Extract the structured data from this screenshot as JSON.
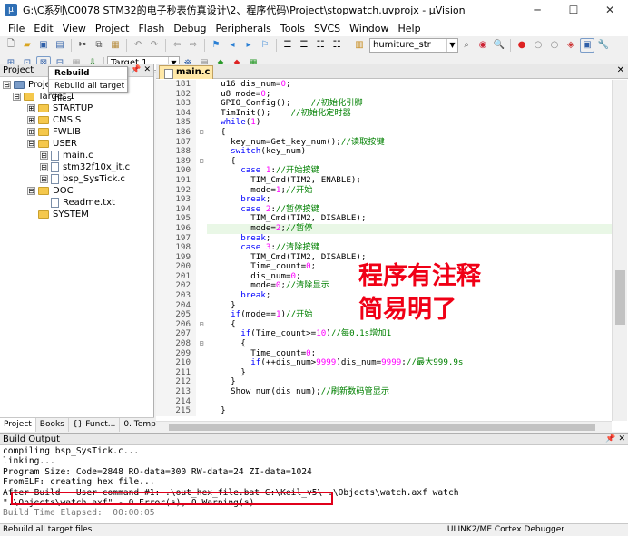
{
  "window": {
    "title": "G:\\C系列\\C0078 STM32的电子秒表仿真设计\\2、程序代码\\Project\\stopwatch.uvprojx - µVision",
    "minimize": "─",
    "maximize": "☐",
    "close": "✕"
  },
  "menu": [
    "File",
    "Edit",
    "View",
    "Project",
    "Flash",
    "Debug",
    "Peripherals",
    "Tools",
    "SVCS",
    "Window",
    "Help"
  ],
  "toolbar": {
    "find_combo": "humiture_str",
    "target_combo": "Target 1"
  },
  "project_panel": {
    "title": "Project",
    "tree": [
      {
        "label": "Project: stopwatch",
        "level": 0,
        "kind": "root",
        "expander": "⊟"
      },
      {
        "label": "Target 1",
        "level": 1,
        "kind": "folder",
        "expander": "⊟"
      },
      {
        "label": "STARTUP",
        "level": 2,
        "kind": "folder",
        "expander": "⊞"
      },
      {
        "label": "CMSIS",
        "level": 2,
        "kind": "folder",
        "expander": "⊞"
      },
      {
        "label": "FWLIB",
        "level": 2,
        "kind": "folder",
        "expander": "⊞"
      },
      {
        "label": "USER",
        "level": 2,
        "kind": "folder",
        "expander": "⊟"
      },
      {
        "label": "main.c",
        "level": 3,
        "kind": "file",
        "expander": "⊞"
      },
      {
        "label": "stm32f10x_it.c",
        "level": 3,
        "kind": "file",
        "expander": "⊞"
      },
      {
        "label": "bsp_SysTick.c",
        "level": 3,
        "kind": "file",
        "expander": "⊞"
      },
      {
        "label": "DOC",
        "level": 2,
        "kind": "folder",
        "expander": "⊟"
      },
      {
        "label": "Readme.txt",
        "level": 3,
        "kind": "file",
        "expander": ""
      },
      {
        "label": "SYSTEM",
        "level": 2,
        "kind": "folder",
        "expander": ""
      }
    ],
    "tooltip": {
      "title": "Rebuild",
      "desc": "Rebuild all target files"
    },
    "tabs": [
      "Project",
      "Books",
      "{} Funct...",
      "0. Templ..."
    ]
  },
  "editor": {
    "tab": "main.c",
    "lines": [
      {
        "n": "181",
        "f": "",
        "code": "  u16 dis_num=0;"
      },
      {
        "n": "182",
        "f": "",
        "code": "  u8 mode=0;"
      },
      {
        "n": "183",
        "f": "",
        "code": "  GPIO_Config();    //初始化引脚"
      },
      {
        "n": "184",
        "f": "",
        "code": "  TimInit();    //初始化定时器"
      },
      {
        "n": "185",
        "f": "",
        "code": "  while(1)"
      },
      {
        "n": "186",
        "f": "⊟",
        "code": "  {"
      },
      {
        "n": "187",
        "f": "",
        "code": "    key_num=Get_key_num();//读取按键"
      },
      {
        "n": "188",
        "f": "",
        "code": "    switch(key_num)"
      },
      {
        "n": "189",
        "f": "⊟",
        "code": "    {"
      },
      {
        "n": "190",
        "f": "",
        "code": "      case 1://开始按键"
      },
      {
        "n": "191",
        "f": "",
        "code": "        TIM_Cmd(TIM2, ENABLE);"
      },
      {
        "n": "192",
        "f": "",
        "code": "        mode=1;//开始"
      },
      {
        "n": "193",
        "f": "",
        "code": "      break;"
      },
      {
        "n": "194",
        "f": "",
        "code": "      case 2://暂停按键"
      },
      {
        "n": "195",
        "f": "",
        "code": "        TIM_Cmd(TIM2, DISABLE);"
      },
      {
        "n": "196",
        "f": "",
        "code": "        mode=2;//暂停"
      },
      {
        "n": "197",
        "f": "",
        "code": "      break;"
      },
      {
        "n": "198",
        "f": "",
        "code": "      case 3://清除按键"
      },
      {
        "n": "199",
        "f": "",
        "code": "        TIM_Cmd(TIM2, DISABLE);"
      },
      {
        "n": "200",
        "f": "",
        "code": "        Time_count=0;"
      },
      {
        "n": "201",
        "f": "",
        "code": "        dis_num=0;"
      },
      {
        "n": "202",
        "f": "",
        "code": "        mode=0;//清除显示"
      },
      {
        "n": "203",
        "f": "",
        "code": "      break;"
      },
      {
        "n": "204",
        "f": "",
        "code": "    }"
      },
      {
        "n": "205",
        "f": "",
        "code": "    if(mode==1)//开始"
      },
      {
        "n": "206",
        "f": "⊟",
        "code": "    {"
      },
      {
        "n": "207",
        "f": "",
        "code": "      if(Time_count>=10)//每0.1s增加1"
      },
      {
        "n": "208",
        "f": "⊟",
        "code": "      {"
      },
      {
        "n": "209",
        "f": "",
        "code": "        Time_count=0;"
      },
      {
        "n": "210",
        "f": "",
        "code": "        if(++dis_num>9999)dis_num=9999;//最大999.9s"
      },
      {
        "n": "211",
        "f": "",
        "code": "      }"
      },
      {
        "n": "212",
        "f": "",
        "code": "    }"
      },
      {
        "n": "213",
        "f": "",
        "code": "    Show_num(dis_num);//刷新数码管显示"
      },
      {
        "n": "214",
        "f": "",
        "code": ""
      },
      {
        "n": "215",
        "f": "",
        "code": "  }"
      }
    ],
    "highlight_line": "196",
    "overlay": [
      "程序有注释",
      "简易明了"
    ]
  },
  "build_output": {
    "title": "Build Output",
    "lines": [
      "compiling bsp_SysTick.c...",
      "linking...",
      "Program Size: Code=2848 RO-data=300 RW-data=24 ZI-data=1024",
      "FromELF: creating hex file...",
      "After Build - User command #1: .\\out_hex_file.bat C:\\Keil_v5\\ .\\Objects\\watch.axf watch",
      "\".\\Objects\\watch.axf\" - 0 Error(s), 0 Warning(s).",
      "Build Time Elapsed:  00:00:05"
    ]
  },
  "status": {
    "left": "Rebuild all target files",
    "right": "ULINK2/ME Cortex Debugger"
  }
}
